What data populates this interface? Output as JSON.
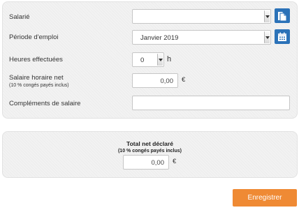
{
  "form": {
    "employee_label": "Salarié",
    "employee_value": "",
    "period_label": "Période d'emploi",
    "period_value": "Janvier 2019",
    "hours_label": "Heures effectuées",
    "hours_value": "0",
    "hours_unit": "h",
    "rate_label": "Salaire horaire net",
    "rate_sublabel": "(10 % congés payés inclus)",
    "rate_value": "0,00",
    "currency": "€",
    "complement_label": "Compléments de salaire",
    "complement_value": ""
  },
  "total": {
    "title": "Total net déclaré",
    "sublabel": "(10 % congés payés inclus)",
    "value": "0,00",
    "currency": "€"
  },
  "actions": {
    "save_label": "Enregistrer"
  },
  "icons": {
    "employee_button": "documents-icon",
    "period_button": "calendar-icon"
  },
  "colors": {
    "accent_blue": "#2b72b8",
    "save_orange": "#ef8a34",
    "panel_bg": "#f2f2f2"
  }
}
